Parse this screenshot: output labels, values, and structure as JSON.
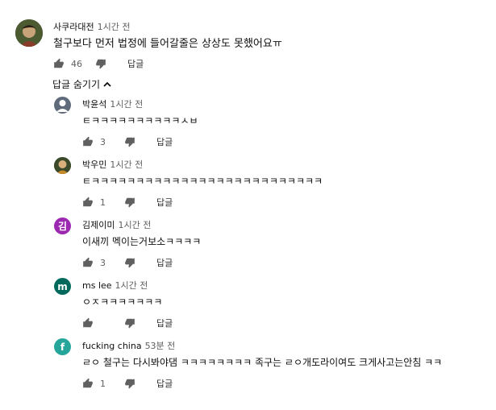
{
  "top_comment": {
    "author": "사쿠라대전",
    "time": "1시간 전",
    "text": "철구보다 먼저 법정에 들어갈줄은 상상도 못했어요ㅠ",
    "likes": "46",
    "reply_label": "답글"
  },
  "hide_replies_label": "답글 숨기기",
  "replies": [
    {
      "author": "박윤석",
      "time": "1시간 전",
      "text": "ㅌㅋㅋㅋㅋㅋㅋㅋㅋㅋㅋㅅㅂ",
      "likes": "3",
      "reply_label": "답글",
      "avatar_letter": "",
      "avatar_color": "#5f6b7a"
    },
    {
      "author": "박우민",
      "time": "1시간 전",
      "text": "ㅌㅋㅋㅋㅋㅋㅋㅋㅋㅋㅋㅋㅋㅋㅋㅋㅋㅋㅋㅋㅋㅋㅋㅋㅋㅋㅋ",
      "likes": "1",
      "reply_label": "답글",
      "avatar_letter": "",
      "avatar_color": "#6a5a3a"
    },
    {
      "author": "김제이미",
      "time": "1시간 전",
      "text": "이새끼 멕이는거보소ㅋㅋㅋㅋ",
      "likes": "3",
      "reply_label": "답글",
      "avatar_letter": "김",
      "avatar_color": "#9c27b0"
    },
    {
      "author": "ms lee",
      "time": "1시간 전",
      "text": "ㅇㅈㅋㅋㅋㅋㅋㅋㅋ",
      "likes": "",
      "reply_label": "답글",
      "avatar_letter": "m",
      "avatar_color": "#00695c"
    },
    {
      "author": "fucking china",
      "time": "53분 전",
      "text": "ㄹㅇ 철구는 다시봐야댐 ㅋㅋㅋㅋㅋㅋㅋㅋ 족구는 ㄹㅇ개도라이여도 크게사고는안침 ㅋㅋ",
      "likes": "1",
      "reply_label": "답글",
      "avatar_letter": "f",
      "avatar_color": "#26a69a"
    }
  ],
  "colors": {
    "meta": "#606060",
    "text": "#0f0f0f"
  }
}
